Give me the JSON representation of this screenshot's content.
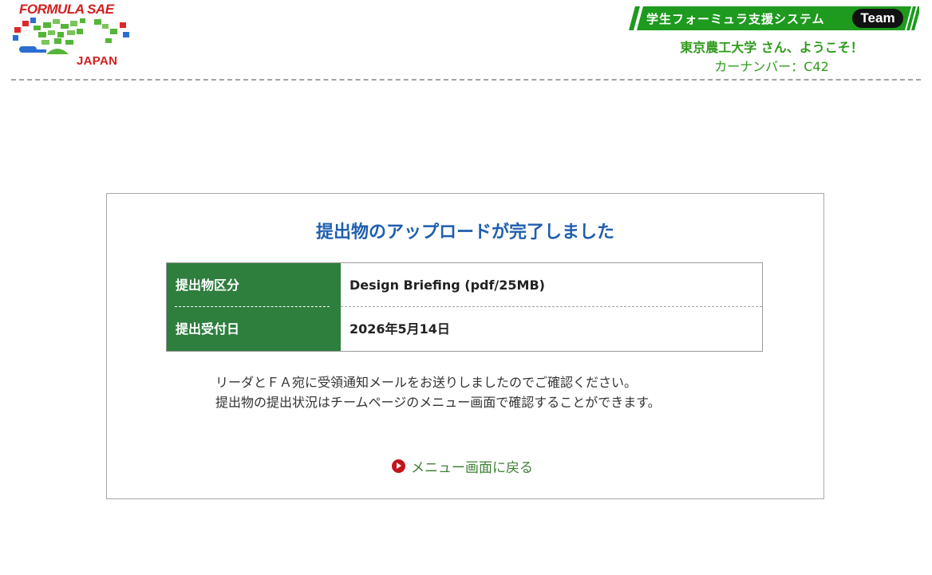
{
  "header": {
    "logo": {
      "title": "FORMULA SAE",
      "subtitle": "JAPAN",
      "icon": "fsae-japan-logo"
    },
    "banner": {
      "label": "学生フォーミュラ支援システム",
      "badge": "Team"
    },
    "welcome": "東京農工大学 さん、ようこそ！",
    "car_number": "カーナンバー：C42"
  },
  "panel": {
    "title": "提出物のアップロードが完了しました",
    "rows": [
      {
        "label": "提出物区分",
        "value": "Design Briefing (pdf/25MB)"
      },
      {
        "label": "提出受付日",
        "value": "2026年5月14日"
      }
    ],
    "notice": [
      "リーダとＦＡ宛に受領通知メールをお送りしましたのでご確認ください。",
      "提出物の提出状況はチームページのメニュー画面で確認することができます。"
    ],
    "back_link": {
      "label": "メニュー画面に戻る",
      "icon": "play-circle-icon"
    }
  },
  "colors": {
    "brand_green": "#2f9a1c",
    "table_header_green": "#2e7e3e",
    "title_blue": "#1f5fae",
    "logo_red": "#d21f1f",
    "link_icon_red": "#c3141c"
  }
}
